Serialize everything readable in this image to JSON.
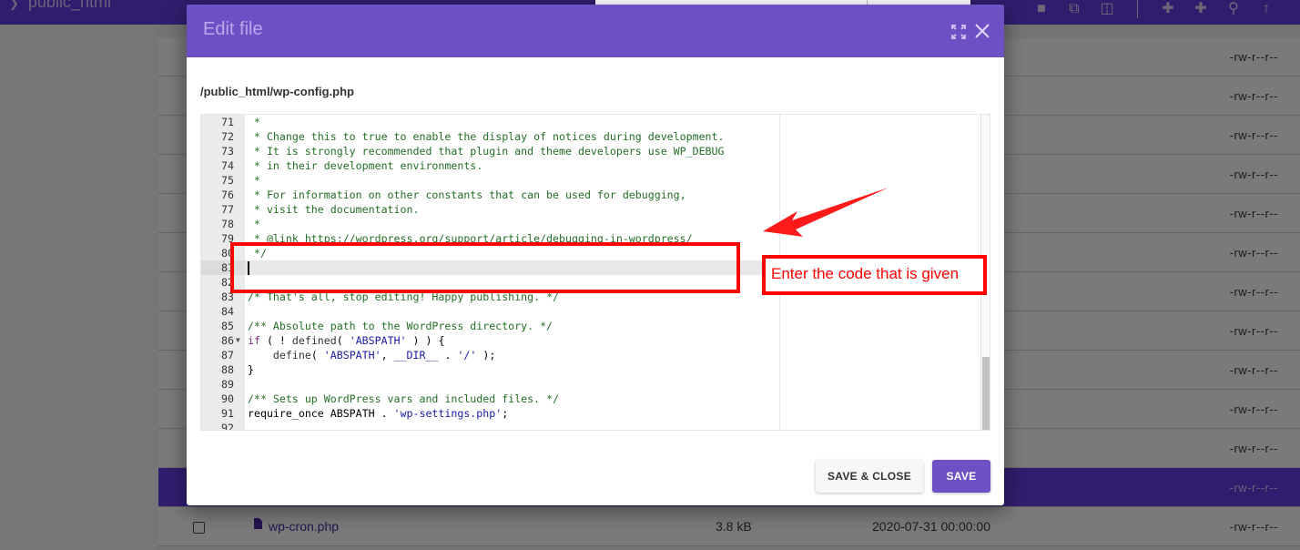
{
  "background": {
    "breadcrumb": "public_html",
    "toolbar_icons": [
      "new-file-icon",
      "copy-icon",
      "delete-icon",
      "add-file-icon",
      "add-folder-icon",
      "search-icon",
      "upload-icon"
    ],
    "rows": [
      {
        "name": "",
        "size": "",
        "date": "",
        "perm": "-rw-r--r--",
        "selected": false
      },
      {
        "name": "",
        "size": "",
        "date": "",
        "perm": "-rw-r--r--",
        "selected": false
      },
      {
        "name": "",
        "size": "",
        "date": "",
        "perm": "-rw-r--r--",
        "selected": false
      },
      {
        "name": "",
        "size": "",
        "date": "",
        "perm": "-rw-r--r--",
        "selected": false
      },
      {
        "name": "",
        "size": "",
        "date": "",
        "perm": "-rw-r--r--",
        "selected": false
      },
      {
        "name": "",
        "size": "",
        "date": "",
        "perm": "-rw-r--r--",
        "selected": false
      },
      {
        "name": "",
        "size": "",
        "date": "",
        "perm": "-rw-r--r--",
        "selected": false
      },
      {
        "name": "",
        "size": "",
        "date": "",
        "perm": "-rw-r--r--",
        "selected": false
      },
      {
        "name": "",
        "size": "",
        "date": "",
        "perm": "-rw-r--r--",
        "selected": false
      },
      {
        "name": "",
        "size": "",
        "date": "",
        "perm": "-rw-r--r--",
        "selected": false
      },
      {
        "name": "",
        "size": "",
        "date": "",
        "perm": "-rw-r--r--",
        "selected": false
      },
      {
        "name": "",
        "size": "",
        "date": "",
        "perm": "-rw-r--r--",
        "selected": true
      },
      {
        "name": "wp-cron.php",
        "size": "3.8 kB",
        "date": "2020-07-31 00:00:00",
        "perm": "-rw-r--r--",
        "selected": false
      }
    ]
  },
  "modal": {
    "title": "Edit file",
    "file_path": "/public_html/wp-config.php",
    "expand_icon": "expand-icon",
    "close_icon": "close-icon",
    "save_close_label": "SAVE & CLOSE",
    "save_label": "SAVE",
    "accent_color": "#6d51c4",
    "editor": {
      "active_line": 81,
      "lines": [
        {
          "n": 71,
          "tokens": [
            {
              "t": " *",
              "c": "comment"
            }
          ]
        },
        {
          "n": 72,
          "tokens": [
            {
              "t": " * Change this to true to enable the display of notices during development.",
              "c": "comment"
            }
          ]
        },
        {
          "n": 73,
          "tokens": [
            {
              "t": " * It is strongly recommended that plugin and theme developers use WP_DEBUG",
              "c": "comment"
            }
          ]
        },
        {
          "n": 74,
          "tokens": [
            {
              "t": " * in their development environments.",
              "c": "comment"
            }
          ]
        },
        {
          "n": 75,
          "tokens": [
            {
              "t": " *",
              "c": "comment"
            }
          ]
        },
        {
          "n": 76,
          "tokens": [
            {
              "t": " * For information on other constants that can be used for debugging,",
              "c": "comment"
            }
          ]
        },
        {
          "n": 77,
          "tokens": [
            {
              "t": " * visit the documentation.",
              "c": "comment"
            }
          ]
        },
        {
          "n": 78,
          "tokens": [
            {
              "t": " *",
              "c": "comment"
            }
          ]
        },
        {
          "n": 79,
          "tokens": [
            {
              "t": " * @link https://wordpress.org/support/article/debugging-in-wordpress/",
              "c": "comment"
            }
          ]
        },
        {
          "n": 80,
          "tokens": [
            {
              "t": " */",
              "c": "comment"
            }
          ]
        },
        {
          "n": 81,
          "tokens": []
        },
        {
          "n": 82,
          "tokens": []
        },
        {
          "n": 83,
          "tokens": [
            {
              "t": "/* That's all, stop editing! Happy publishing. */",
              "c": "comment"
            }
          ]
        },
        {
          "n": 84,
          "tokens": []
        },
        {
          "n": 85,
          "tokens": [
            {
              "t": "/** Absolute path to the WordPress directory. */",
              "c": "comment"
            }
          ]
        },
        {
          "n": 86,
          "fold": true,
          "tokens": [
            {
              "t": "if",
              "c": "kw"
            },
            {
              "t": " ( ! ",
              "c": "plain"
            },
            {
              "t": "defined",
              "c": "fn"
            },
            {
              "t": "( ",
              "c": "plain"
            },
            {
              "t": "'ABSPATH'",
              "c": "str"
            },
            {
              "t": " ) ) {",
              "c": "plain"
            }
          ]
        },
        {
          "n": 87,
          "tokens": [
            {
              "t": "    ",
              "c": "plain"
            },
            {
              "t": "define",
              "c": "fn"
            },
            {
              "t": "( ",
              "c": "plain"
            },
            {
              "t": "'ABSPATH'",
              "c": "str"
            },
            {
              "t": ", ",
              "c": "plain"
            },
            {
              "t": "__DIR__",
              "c": "str"
            },
            {
              "t": " . ",
              "c": "plain"
            },
            {
              "t": "'/'",
              "c": "str"
            },
            {
              "t": " );",
              "c": "plain"
            }
          ]
        },
        {
          "n": 88,
          "tokens": [
            {
              "t": "}",
              "c": "plain"
            }
          ]
        },
        {
          "n": 89,
          "tokens": []
        },
        {
          "n": 90,
          "tokens": [
            {
              "t": "/** Sets up WordPress vars and included files. */",
              "c": "comment"
            }
          ]
        },
        {
          "n": 91,
          "tokens": [
            {
              "t": "require_once",
              "c": "plain"
            },
            {
              "t": " ABSPATH . ",
              "c": "plain"
            },
            {
              "t": "'wp-settings.php'",
              "c": "str"
            },
            {
              "t": ";",
              "c": "plain"
            }
          ]
        },
        {
          "n": 92,
          "tokens": []
        }
      ]
    }
  },
  "annotation": {
    "label": "Enter the code that is given",
    "color": "#ff0000"
  }
}
